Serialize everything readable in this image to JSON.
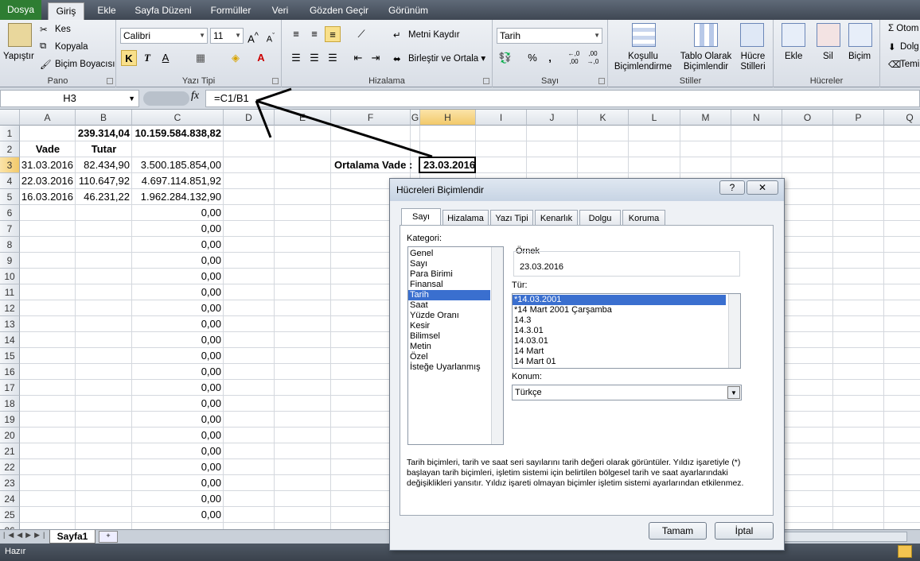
{
  "ribbon_tabs": [
    "Dosya",
    "Giriş",
    "Ekle",
    "Sayfa Düzeni",
    "Formüller",
    "Veri",
    "Gözden Geçir",
    "Görünüm"
  ],
  "clipboard": {
    "paste": "Yapıştır",
    "cut": "Kes",
    "copy": "Kopyala",
    "painter": "Biçim Boyacısı",
    "label": "Pano"
  },
  "font": {
    "name": "Calibri",
    "size": "11",
    "bold": "K",
    "italic": "T",
    "underline": "A",
    "label": "Yazı Tipi"
  },
  "alignment": {
    "wrap": "Metni Kaydır",
    "merge": "Birleştir ve Ortala",
    "label": "Hizalama"
  },
  "number": {
    "format": "Tarih",
    "percent": "%",
    "comma": ",",
    "inc": ",0 ,00",
    "dec": ",00 ,0",
    "label": "Sayı"
  },
  "styles": {
    "cond_line1": "Koşullu",
    "cond_line2": "Biçimlendirme",
    "table_line1": "Tablo Olarak",
    "table_line2": "Biçimlendir",
    "cell_line1": "Hücre",
    "cell_line2": "Stilleri",
    "label": "Stiller"
  },
  "cells": {
    "insert": "Ekle",
    "delete": "Sil",
    "format": "Biçim",
    "label": "Hücreler"
  },
  "editing": {
    "autosum": "Σ Otom",
    "fill": "Dolg",
    "clear": "Temi"
  },
  "name_box": "H3",
  "fx": "fx",
  "formula": "=C1/B1",
  "columns": [
    "A",
    "B",
    "C",
    "D",
    "E",
    "F",
    "G",
    "H",
    "I",
    "J",
    "K",
    "L",
    "M",
    "N",
    "O",
    "P",
    "Q"
  ],
  "rows": [
    "1",
    "2",
    "3",
    "4",
    "5",
    "6",
    "7",
    "8",
    "9",
    "10",
    "11",
    "12",
    "13",
    "14",
    "15",
    "16",
    "17",
    "18",
    "19",
    "20",
    "21",
    "22",
    "23",
    "24",
    "25",
    "26"
  ],
  "sheet": {
    "B1": "239.314,04",
    "C1": "10.159.584.838,82",
    "A2": "Vade",
    "B2": "Tutar",
    "A3": "31.03.2016",
    "B3": "82.434,90",
    "C3": "3.500.185.854,00",
    "A4": "22.03.2016",
    "B4": "110.647,92",
    "C4": "4.697.114.851,92",
    "A5": "16.03.2016",
    "B5": "46.231,22",
    "C5": "1.962.284.132,90",
    "zero": "0,00",
    "F3": "Ortalama Vade  :",
    "H3": "23.03.2016"
  },
  "sheet_tab": "Sayfa1",
  "status": "Hazır",
  "dialog": {
    "title": "Hücreleri Biçimlendir",
    "help": "?",
    "close": "✕",
    "tabs": [
      "Sayı",
      "Hizalama",
      "Yazı Tipi",
      "Kenarlık",
      "Dolgu",
      "Koruma"
    ],
    "category_label": "Kategori:",
    "categories": [
      "Genel",
      "Sayı",
      "Para Birimi",
      "Finansal",
      "Tarih",
      "Saat",
      "Yüzde Oranı",
      "Kesir",
      "Bilimsel",
      "Metin",
      "Özel",
      "İsteğe Uyarlanmış"
    ],
    "sample_label": "Örnek",
    "sample": "23.03.2016",
    "type_label": "Tür:",
    "types": [
      "*14.03.2001",
      "*14 Mart 2001 Çarşamba",
      "14.3",
      "14.3.01",
      "14.03.01",
      "14 Mart",
      "14 Mart 01"
    ],
    "locale_label": "Konum:",
    "locale": "Türkçe",
    "description": "Tarih biçimleri, tarih ve saat seri sayılarını tarih değeri olarak görüntüler. Yıldız işaretiyle (*) başlayan tarih biçimleri, işletim sistemi için belirtilen bölgesel tarih ve saat ayarlarındaki değişiklikleri yansıtır. Yıldız işareti olmayan biçimler işletim sistemi ayarlarından etkilenmez.",
    "ok": "Tamam",
    "cancel": "İptal"
  },
  "colors": {
    "accent": "#3a6fcf",
    "file_tab": "#2e7d32"
  }
}
